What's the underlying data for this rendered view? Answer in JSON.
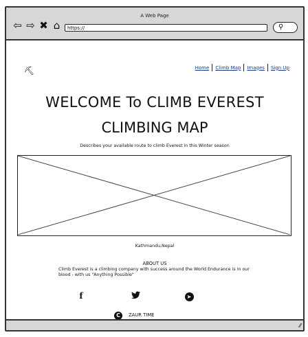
{
  "browser": {
    "title": "A Web Page",
    "url": "https://",
    "nav_icons": [
      {
        "name": "back-arrow-icon",
        "glyph": "⇦"
      },
      {
        "name": "forward-arrow-icon",
        "glyph": "⇨"
      },
      {
        "name": "close-icon",
        "glyph": "✖"
      },
      {
        "name": "home-icon",
        "glyph": "⌂"
      }
    ],
    "search_icon": "search-icon"
  },
  "header": {
    "logo_icon": "climber-icon",
    "nav": [
      {
        "label": "Home"
      },
      {
        "label": "Climb Map"
      },
      {
        "label": "Images"
      },
      {
        "label": "Sign Up"
      }
    ]
  },
  "hero": {
    "title": "WELCOME To CLIMB EVEREST",
    "subtitle": "CLIMBING MAP",
    "description": "Describes your available route to climb Everest in this Winter season"
  },
  "map": {
    "placeholder_icon": "image-placeholder",
    "location": "Kathmandu,Nepal"
  },
  "about": {
    "title": "ABOUT US",
    "text": "Climb Everest is a climbing company with success around the World.Endurance is in our blood - with us \"Anything Possible\""
  },
  "social": [
    {
      "name": "facebook-icon",
      "glyph": "f"
    },
    {
      "name": "twitter-icon",
      "glyph": "🐦"
    },
    {
      "name": "telegram-icon",
      "glyph": "➤"
    }
  ],
  "footer": {
    "copyright_icon": "copyright-icon",
    "copyright_text": "ZAUR TIME"
  }
}
